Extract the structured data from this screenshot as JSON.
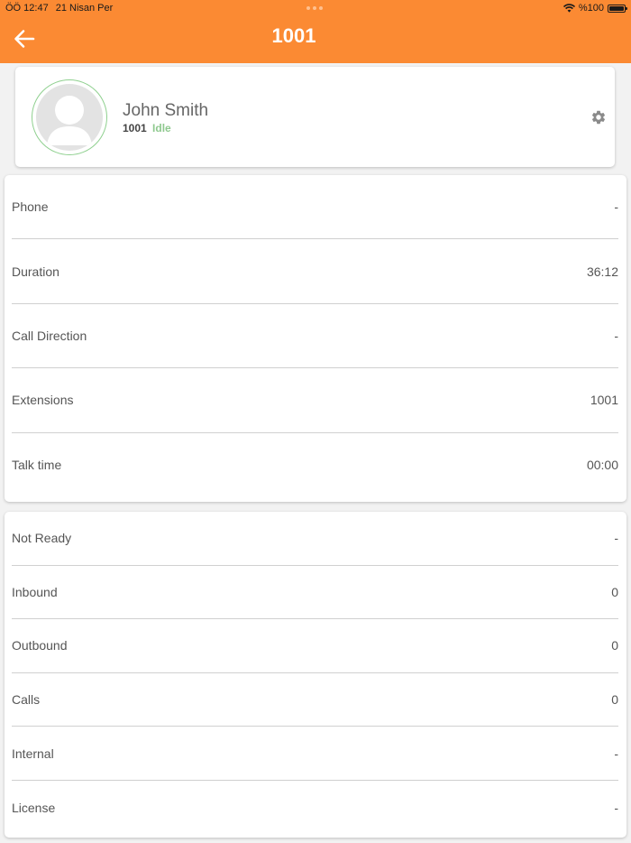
{
  "status_bar": {
    "time": "ÖÖ 12:47",
    "date": "21 Nisan Per",
    "battery": "%100"
  },
  "header": {
    "title": "1001",
    "background": "#fb8a33"
  },
  "profile": {
    "name": "John Smith",
    "extension": "1001",
    "status": "Idle",
    "status_color": "#8fc98f"
  },
  "call_info": [
    {
      "label": "Phone",
      "value": "-"
    },
    {
      "label": "Duration",
      "value": "36:12"
    },
    {
      "label": "Call Direction",
      "value": "-"
    },
    {
      "label": "Extensions",
      "value": "1001"
    },
    {
      "label": "Talk time",
      "value": "00:00"
    }
  ],
  "stats": [
    {
      "label": "Not Ready",
      "value": "-"
    },
    {
      "label": "Inbound",
      "value": "0"
    },
    {
      "label": "Outbound",
      "value": "0"
    },
    {
      "label": "Calls",
      "value": "0"
    },
    {
      "label": "Internal",
      "value": "-"
    },
    {
      "label": "License",
      "value": "-"
    }
  ]
}
